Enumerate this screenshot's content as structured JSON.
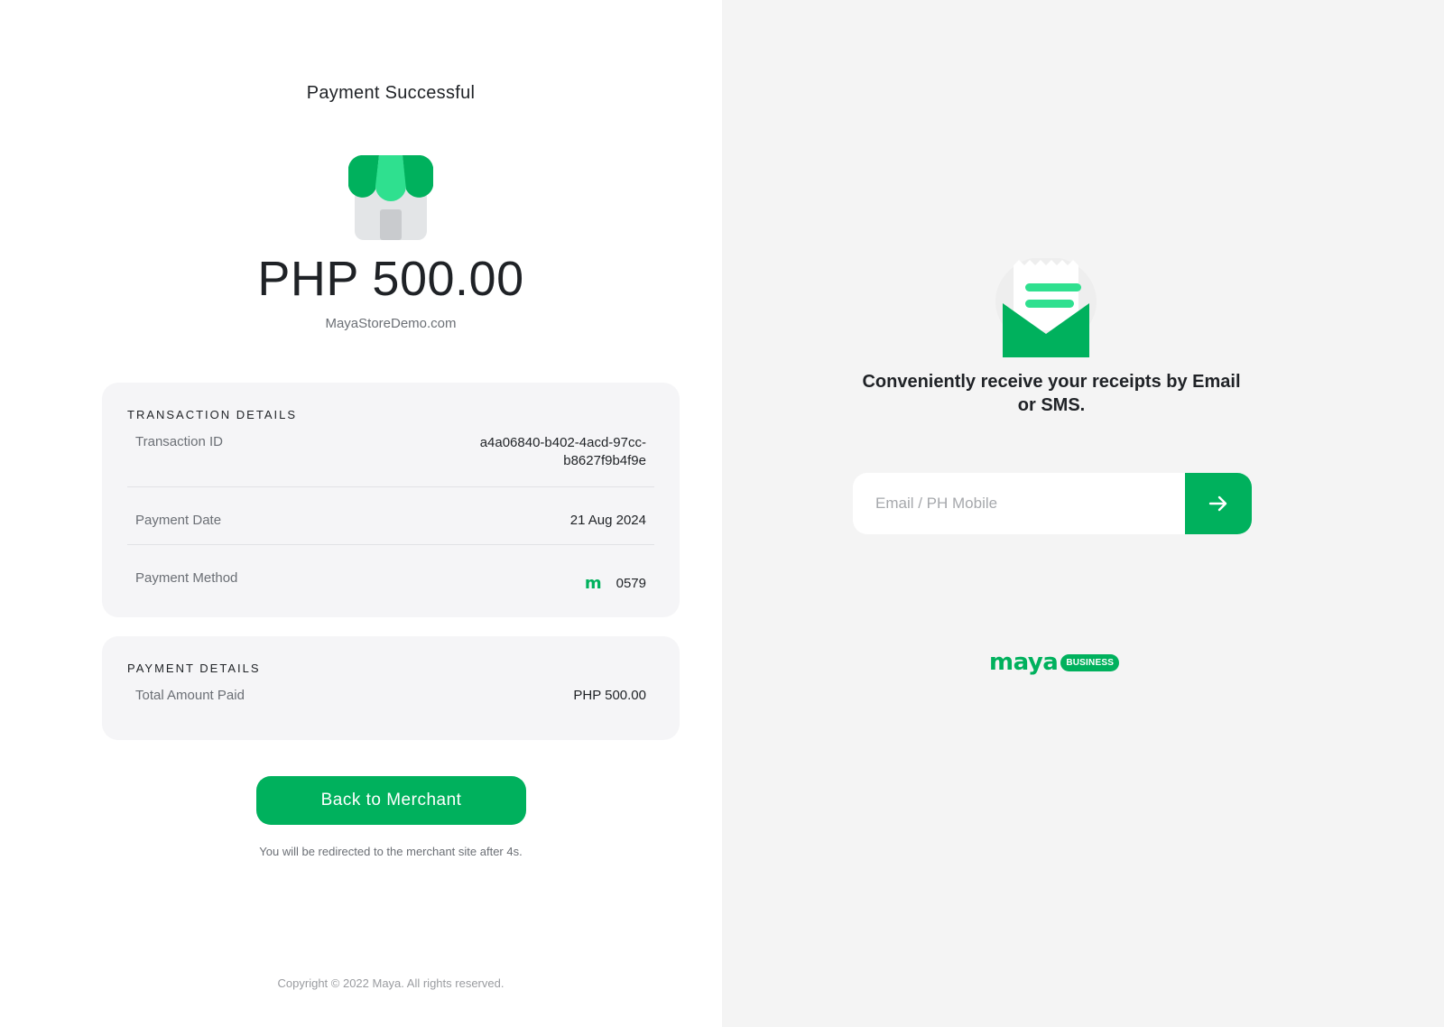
{
  "payment": {
    "title": "Payment Successful",
    "amount": "PHP 500.00",
    "merchant": "MayaStoreDemo.com"
  },
  "transaction_details": {
    "title": "TRANSACTION DETAILS",
    "rows": [
      {
        "label": "Transaction ID",
        "value": "a4a06840-b402-4acd-97cc-b8627f9b4f9e"
      },
      {
        "label": "Payment Date",
        "value": "21 Aug 2024"
      },
      {
        "label": "Payment Method",
        "value": "0579",
        "icon": "maya-m-icon"
      }
    ]
  },
  "payment_details": {
    "title": "PAYMENT DETAILS",
    "rows": [
      {
        "label": "Total Amount Paid",
        "value": "PHP 500.00"
      }
    ]
  },
  "actions": {
    "back_label": "Back to Merchant",
    "redirect_text": "You will be redirected to the merchant site after 4s."
  },
  "footer": {
    "copyright": "Copyright © 2022 Maya. All rights reserved."
  },
  "receipt": {
    "text": "Conveniently receive your receipts by Email or SMS.",
    "input_placeholder": "Email / PH Mobile",
    "input_value": "",
    "submit_icon": "arrow-right-icon"
  },
  "brand": {
    "logo_text": "maya",
    "badge_text": "BUSINESS",
    "accent_color": "#00b15d"
  }
}
